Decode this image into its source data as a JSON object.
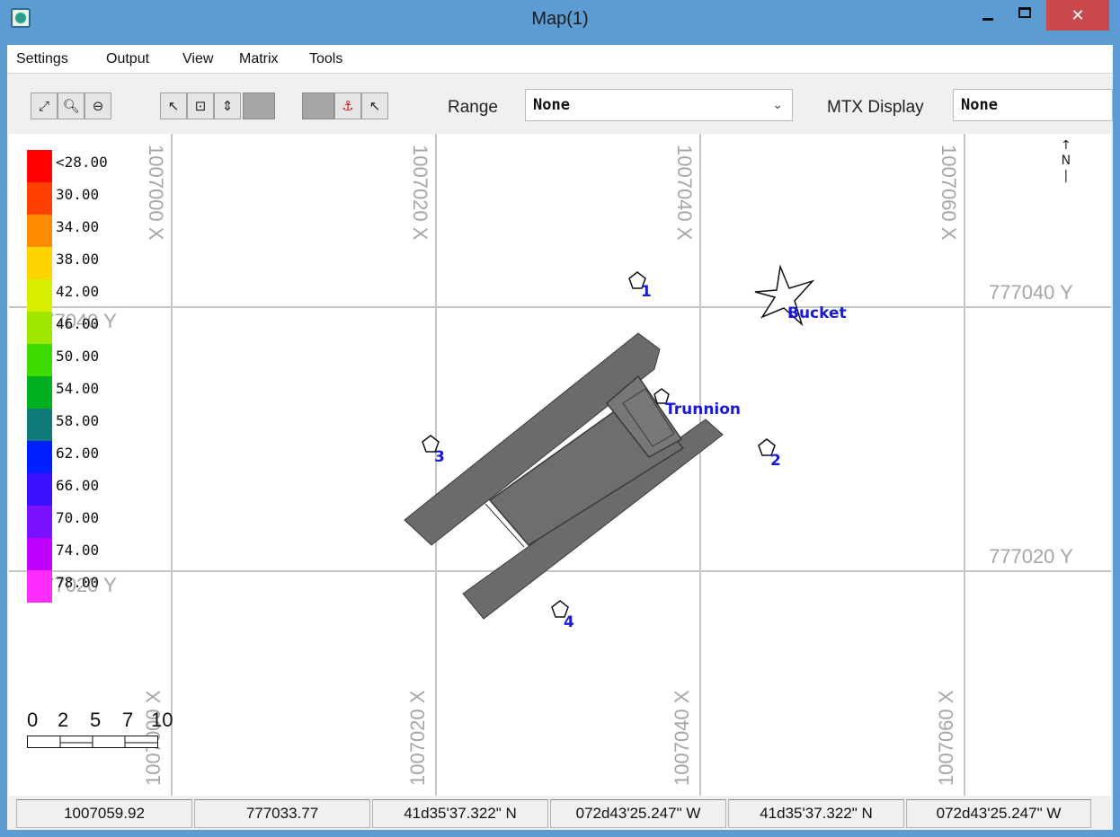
{
  "window": {
    "title": "Map(1)",
    "close_glyph": "✕"
  },
  "menu": {
    "items": [
      "Settings",
      "Output",
      "View",
      "Matrix",
      "Tools"
    ]
  },
  "toolbar": {
    "icons": [
      "zoom-extents-icon",
      "zoom-in-icon",
      "zoom-out-icon",
      "pointer-icon",
      "zoom-window-icon",
      "zoom-pan-icon",
      "blank-tool-1",
      "blank-tool-2",
      "anchor-icon",
      "query-pointer-icon"
    ],
    "range_label": "Range",
    "range_value": "None",
    "mtx_label": "MTX Display",
    "mtx_value": "None"
  },
  "map": {
    "grid_x_labels": [
      "1007000 X",
      "1007020 X",
      "1007040 X",
      "1007060 X"
    ],
    "grid_y_labels": [
      "777040 Y",
      "777020 Y"
    ],
    "legend": [
      {
        "label": "<28.00",
        "color": "#ff0000"
      },
      {
        "label": "30.00",
        "color": "#ff4000"
      },
      {
        "label": "34.00",
        "color": "#ff8c00"
      },
      {
        "label": "38.00",
        "color": "#ffd400"
      },
      {
        "label": "42.00",
        "color": "#d8f000"
      },
      {
        "label": "46.00",
        "color": "#a0e800"
      },
      {
        "label": "50.00",
        "color": "#40dc00"
      },
      {
        "label": "54.00",
        "color": "#00b020"
      },
      {
        "label": "58.00",
        "color": "#107a7a"
      },
      {
        "label": "62.00",
        "color": "#0020ff"
      },
      {
        "label": "66.00",
        "color": "#3a10ff"
      },
      {
        "label": "70.00",
        "color": "#7a10ff"
      },
      {
        "label": "74.00",
        "color": "#c000ff"
      },
      {
        "label": "78.00",
        "color": "#ff2cff"
      }
    ],
    "scale_labels": [
      "0",
      "2",
      "5",
      "7",
      "10"
    ],
    "north_label": "N",
    "points": [
      {
        "label": "1"
      },
      {
        "label": "2"
      },
      {
        "label": "3"
      },
      {
        "label": "4"
      },
      {
        "label": "Trunnion"
      },
      {
        "label": "Bucket"
      }
    ]
  },
  "status": {
    "cells": [
      "1007059.92",
      "777033.77",
      "41d35'37.322\" N",
      "072d43'25.247\" W",
      "41d35'37.322\" N",
      "072d43'25.247\" W"
    ]
  }
}
